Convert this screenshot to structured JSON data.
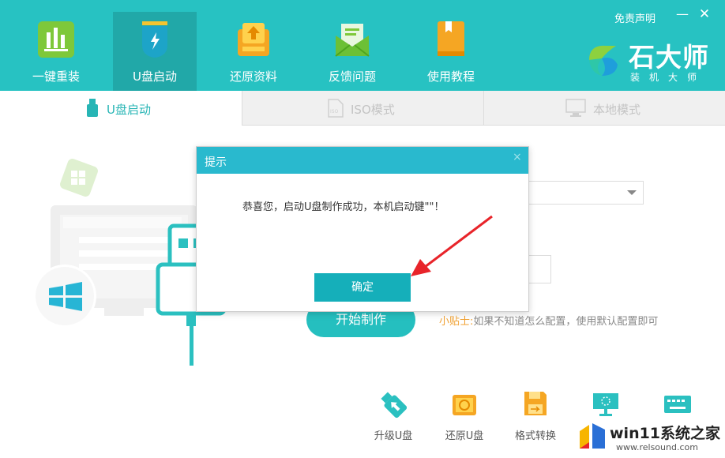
{
  "header": {
    "nav": [
      {
        "label": "一键重装",
        "icon": "chart-icon"
      },
      {
        "label": "U盘启动",
        "icon": "usb-icon"
      },
      {
        "label": "还原资料",
        "icon": "restore-icon"
      },
      {
        "label": "反馈问题",
        "icon": "mail-icon"
      },
      {
        "label": "使用教程",
        "icon": "book-icon"
      }
    ],
    "disclaimer": "免责声明",
    "minimize": "—",
    "close": "✕",
    "logo_title": "石大师",
    "logo_sub": "装机大师"
  },
  "tabs": [
    {
      "label": "U盘启动",
      "icon": "usb-drive-icon"
    },
    {
      "label": "ISO模式",
      "icon": "iso-file-icon"
    },
    {
      "label": "本地模式",
      "icon": "monitor-icon"
    }
  ],
  "main": {
    "start_button": "开始制作",
    "tip_label": "小贴士:",
    "tip_text": "如果不知道怎么配置，使用默认配置即可"
  },
  "dialog": {
    "title": "提示",
    "close": "×",
    "message": "恭喜您，启动U盘制作成功，本机启动键\"\"！",
    "ok": "确定"
  },
  "tools": [
    {
      "label": "升级U盘",
      "icon": "upgrade-usb-icon"
    },
    {
      "label": "还原U盘",
      "icon": "restore-usb-icon"
    },
    {
      "label": "格式转换",
      "icon": "format-convert-icon"
    },
    {
      "label": "",
      "icon": "simulate-boot-icon"
    },
    {
      "label": "",
      "icon": "shortcut-key-icon"
    }
  ],
  "watermark": {
    "text": "win11系统之家",
    "url": "www.relsound.com"
  },
  "colors": {
    "header": "#27c2c2",
    "dialog_title": "#29b9ce",
    "ok_button": "#15afba",
    "tip_label": "#f0a030",
    "arrow": "#e8242a"
  }
}
